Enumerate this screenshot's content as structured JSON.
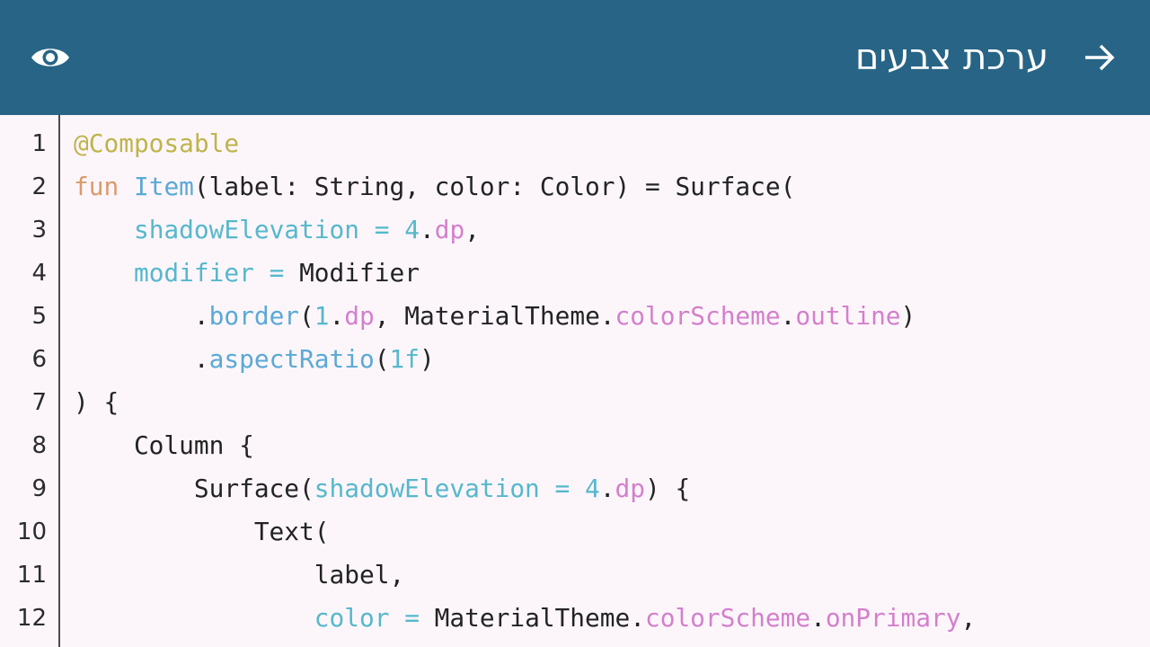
{
  "app_bar": {
    "title": "ערכת צבעים",
    "back_icon": "arrow-right-icon",
    "preview_icon": "eye-icon",
    "background": "#286486"
  },
  "editor": {
    "line_numbers": [
      "1",
      "2",
      "3",
      "4",
      "5",
      "6",
      "7",
      "8",
      "9",
      "10",
      "11",
      "12"
    ],
    "lines": [
      [
        {
          "t": "@Composable",
          "c": "ann"
        }
      ],
      [
        {
          "t": "fun",
          "c": "kw"
        },
        {
          "t": " ",
          "c": "pl"
        },
        {
          "t": "Item",
          "c": "fn"
        },
        {
          "t": "(label: String, color: Color) = Surface(",
          "c": "pl"
        }
      ],
      [
        {
          "t": "    ",
          "c": "pl"
        },
        {
          "t": "shadowElevation",
          "c": "prm"
        },
        {
          "t": " = ",
          "c": "prm"
        },
        {
          "t": "4",
          "c": "num"
        },
        {
          "t": ".",
          "c": "pl"
        },
        {
          "t": "dp",
          "c": "prop"
        },
        {
          "t": ",",
          "c": "pl"
        }
      ],
      [
        {
          "t": "    ",
          "c": "pl"
        },
        {
          "t": "modifier",
          "c": "prm"
        },
        {
          "t": " = ",
          "c": "prm"
        },
        {
          "t": "Modifier",
          "c": "pl"
        }
      ],
      [
        {
          "t": "        .",
          "c": "pl"
        },
        {
          "t": "border",
          "c": "fn"
        },
        {
          "t": "(",
          "c": "pl"
        },
        {
          "t": "1",
          "c": "num"
        },
        {
          "t": ".",
          "c": "pl"
        },
        {
          "t": "dp",
          "c": "prop"
        },
        {
          "t": ", MaterialTheme.",
          "c": "pl"
        },
        {
          "t": "colorScheme",
          "c": "prop"
        },
        {
          "t": ".",
          "c": "pl"
        },
        {
          "t": "outline",
          "c": "prop"
        },
        {
          "t": ")",
          "c": "pl"
        }
      ],
      [
        {
          "t": "        .",
          "c": "pl"
        },
        {
          "t": "aspectRatio",
          "c": "fn"
        },
        {
          "t": "(",
          "c": "pl"
        },
        {
          "t": "1f",
          "c": "num"
        },
        {
          "t": ")",
          "c": "pl"
        }
      ],
      [
        {
          "t": ") {",
          "c": "pl"
        }
      ],
      [
        {
          "t": "    Column {",
          "c": "pl"
        }
      ],
      [
        {
          "t": "        Surface(",
          "c": "pl"
        },
        {
          "t": "shadowElevation",
          "c": "prm"
        },
        {
          "t": " = ",
          "c": "prm"
        },
        {
          "t": "4",
          "c": "num"
        },
        {
          "t": ".",
          "c": "pl"
        },
        {
          "t": "dp",
          "c": "prop"
        },
        {
          "t": ") {",
          "c": "pl"
        }
      ],
      [
        {
          "t": "            Text(",
          "c": "pl"
        }
      ],
      [
        {
          "t": "                label,",
          "c": "pl"
        }
      ],
      [
        {
          "t": "                ",
          "c": "pl"
        },
        {
          "t": "color",
          "c": "prm"
        },
        {
          "t": " = ",
          "c": "prm"
        },
        {
          "t": "MaterialTheme.",
          "c": "pl"
        },
        {
          "t": "colorScheme",
          "c": "prop"
        },
        {
          "t": ".",
          "c": "pl"
        },
        {
          "t": "onPrimary",
          "c": "prop"
        },
        {
          "t": ",",
          "c": "pl"
        }
      ]
    ]
  }
}
